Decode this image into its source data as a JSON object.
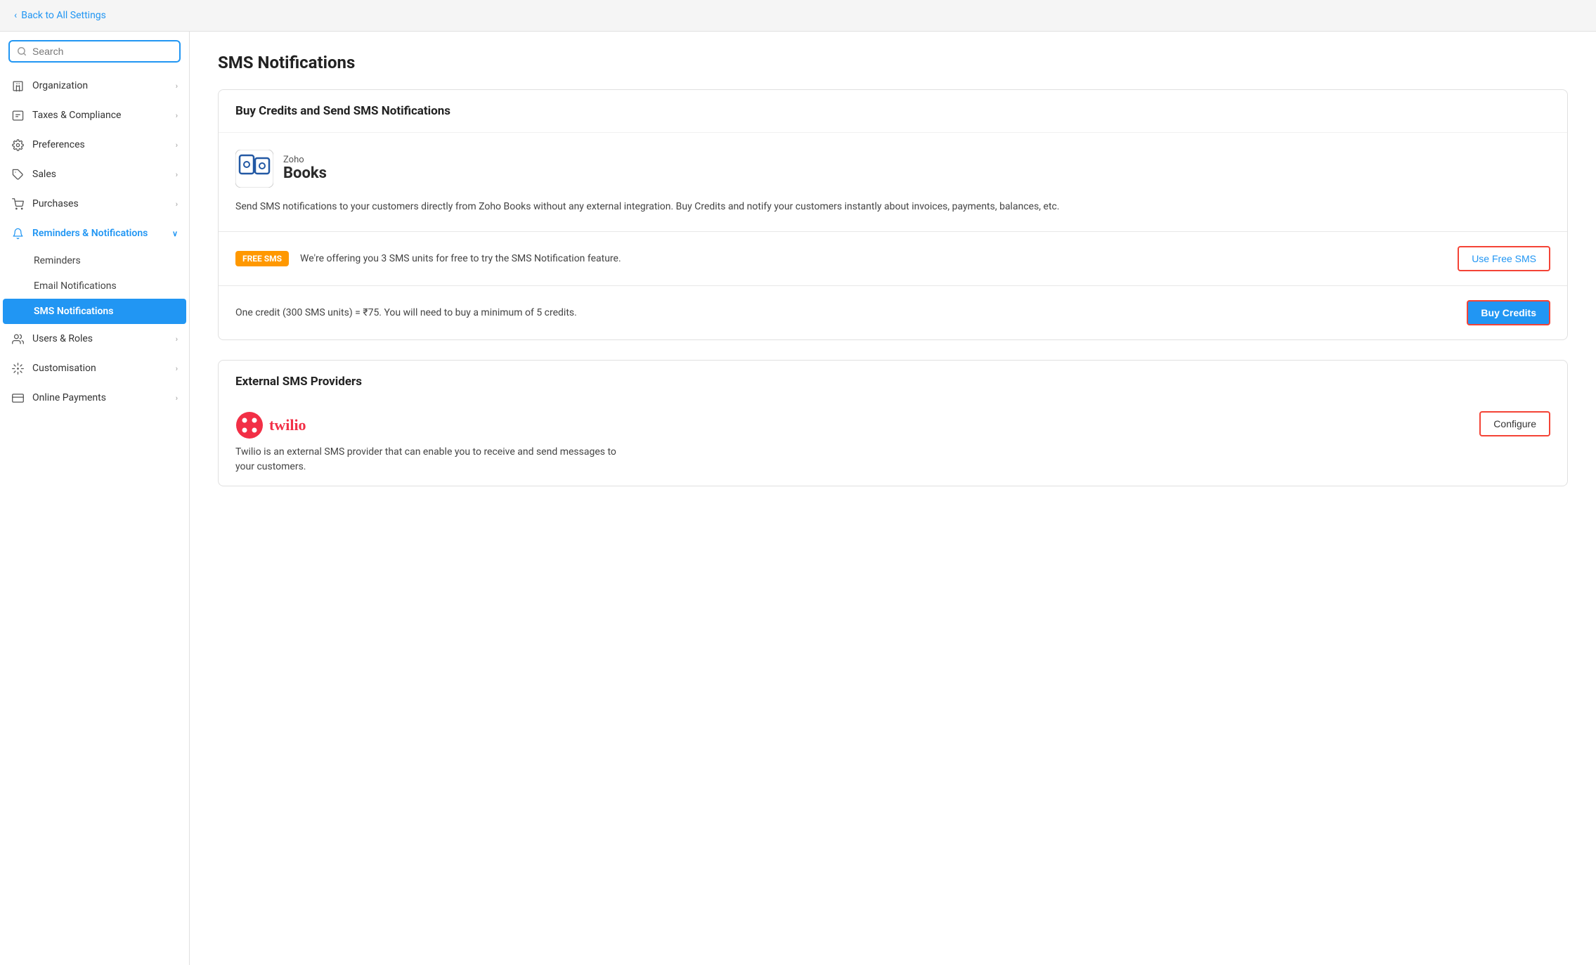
{
  "topbar": {
    "back_label": "Back to All Settings"
  },
  "sidebar": {
    "search_placeholder": "Search",
    "items": [
      {
        "id": "organization",
        "label": "Organization",
        "icon": "building",
        "has_children": true,
        "active": false
      },
      {
        "id": "taxes",
        "label": "Taxes & Compliance",
        "icon": "tax",
        "has_children": true,
        "active": false
      },
      {
        "id": "preferences",
        "label": "Preferences",
        "icon": "sliders",
        "has_children": true,
        "active": false
      },
      {
        "id": "sales",
        "label": "Sales",
        "icon": "tag",
        "has_children": true,
        "active": false
      },
      {
        "id": "purchases",
        "label": "Purchases",
        "icon": "cart",
        "has_children": true,
        "active": false
      },
      {
        "id": "reminders",
        "label": "Reminders & Notifications",
        "icon": "bell",
        "has_children": true,
        "active": true,
        "expanded": true
      },
      {
        "id": "users",
        "label": "Users & Roles",
        "icon": "users",
        "has_children": true,
        "active": false
      },
      {
        "id": "customisation",
        "label": "Customisation",
        "icon": "brush",
        "has_children": true,
        "active": false
      },
      {
        "id": "online-payments",
        "label": "Online Payments",
        "icon": "credit-card",
        "has_children": true,
        "active": false
      }
    ],
    "sub_items": [
      {
        "id": "reminders-sub",
        "label": "Reminders",
        "active": false
      },
      {
        "id": "email-notifications",
        "label": "Email Notifications",
        "active": false
      },
      {
        "id": "sms-notifications",
        "label": "SMS Notifications",
        "active": true
      }
    ]
  },
  "main": {
    "page_title": "SMS Notifications",
    "buy_section": {
      "heading": "Buy Credits and Send SMS Notifications",
      "zoho_books": {
        "brand": "Zoho",
        "product": "Books"
      },
      "description": "Send SMS notifications to your customers directly from Zoho Books without any external integration. Buy Credits and notify your customers instantly about invoices, payments, balances, etc.",
      "free_sms": {
        "badge": "FREE SMS",
        "text": "We're offering you 3 SMS units for free to try the SMS Notification feature.",
        "button_label": "Use Free SMS"
      },
      "buy_credits": {
        "text": "One credit (300 SMS units) = ₹75. You will need to buy a minimum of 5 credits.",
        "button_label": "Buy Credits"
      }
    },
    "external_section": {
      "heading": "External SMS Providers",
      "twilio": {
        "name": "twilio",
        "description": "Twilio is an external SMS provider that can enable you to receive and send messages to your customers.",
        "button_label": "Configure"
      }
    }
  }
}
